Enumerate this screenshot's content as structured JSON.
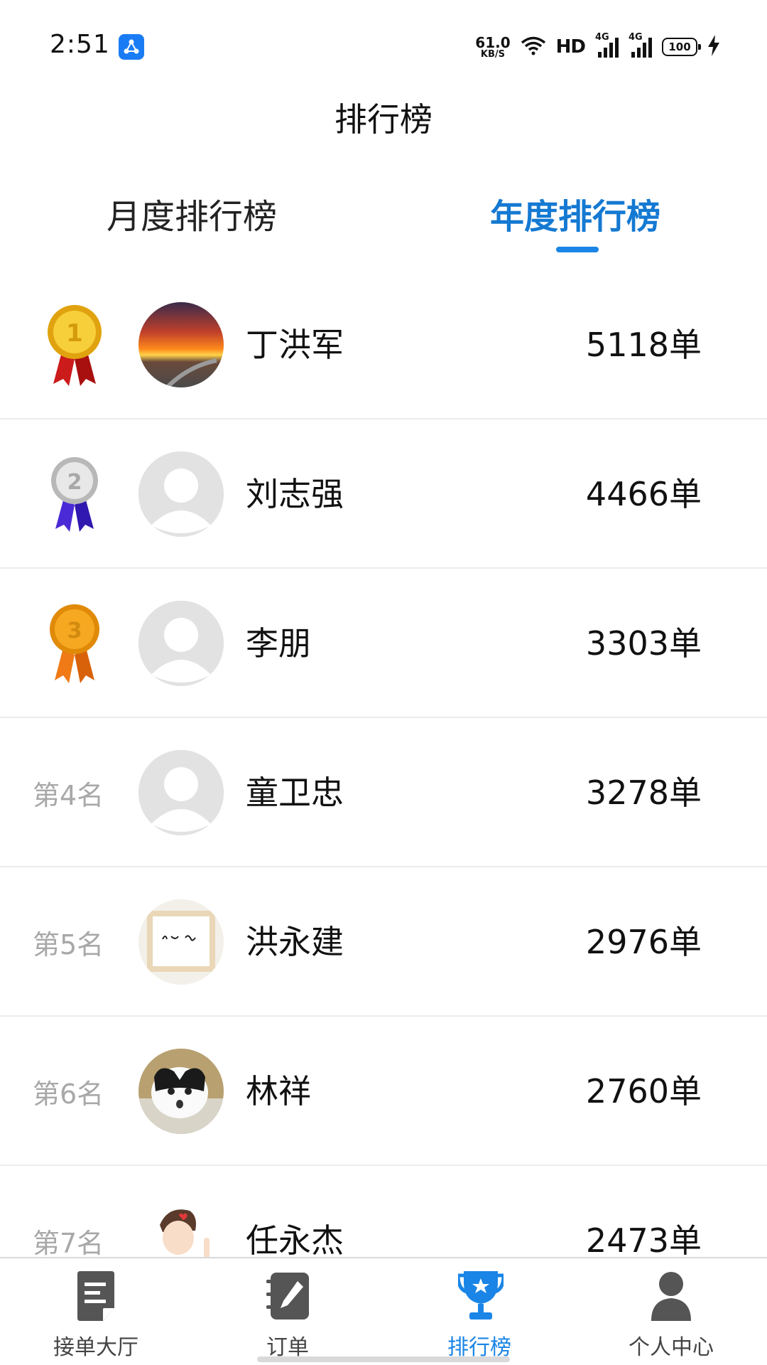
{
  "status_bar": {
    "time": "2:51",
    "net_speed": "61.0",
    "net_speed_unit": "KB/S",
    "hd_label": "HD",
    "signal_1_tag": "4G",
    "signal_2_tag": "4G",
    "battery": "100",
    "icons": [
      "app-notification-icon",
      "wifi-icon",
      "signal-icon",
      "battery-icon",
      "charging-icon"
    ]
  },
  "header": {
    "title": "排行榜"
  },
  "tabs": [
    {
      "label": "月度排行榜",
      "active": false
    },
    {
      "label": "年度排行榜",
      "active": true
    }
  ],
  "accent_color": "#1a85e6",
  "rankings": [
    {
      "rank": 1,
      "badge": "gold-medal-icon",
      "name": "丁洪军",
      "count": "5118单",
      "avatar": "sunset-road-photo"
    },
    {
      "rank": 2,
      "badge": "silver-medal-icon",
      "name": "刘志强",
      "count": "4466单",
      "avatar": "default-user-avatar"
    },
    {
      "rank": 3,
      "badge": "bronze-medal-icon",
      "name": "李朋",
      "count": "3303单",
      "avatar": "default-user-avatar"
    },
    {
      "rank_label": "第4名",
      "name": "童卫忠",
      "count": "3278单",
      "avatar": "default-user-avatar"
    },
    {
      "rank_label": "第5名",
      "name": "洪永建",
      "count": "2976单",
      "avatar": "calligraphy-photo"
    },
    {
      "rank_label": "第6名",
      "name": "林祥",
      "count": "2760单",
      "avatar": "cat-photo"
    },
    {
      "rank_label": "第7名",
      "name": "任永杰",
      "count": "2473单",
      "avatar": "cartoon-person-photo"
    }
  ],
  "bottom_nav": [
    {
      "label": "接单大厅",
      "icon": "document-icon",
      "active": false
    },
    {
      "label": "订单",
      "icon": "notebook-pen-icon",
      "active": false
    },
    {
      "label": "排行榜",
      "icon": "trophy-icon",
      "active": true
    },
    {
      "label": "个人中心",
      "icon": "person-icon",
      "active": false
    }
  ]
}
